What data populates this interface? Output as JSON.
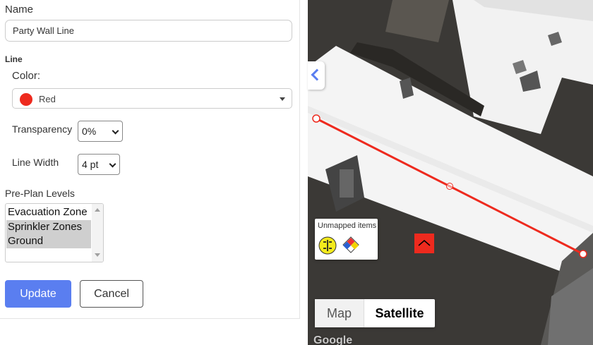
{
  "form": {
    "name_label": "Name",
    "name_value": "Party Wall Line",
    "line_section": "Line",
    "color_label": "Color:",
    "color_value": "Red",
    "color_hex": "#ee2a1e",
    "transparency_label": "Transparency",
    "transparency_value": "0%",
    "line_width_label": "Line Width",
    "line_width_value": "4 pt",
    "preplan_label": "Pre-Plan Levels",
    "preplan_options": [
      "Evacuation Zone",
      "Sprinkler Zones",
      "Ground"
    ],
    "preplan_selected": [
      "Sprinkler Zones",
      "Ground"
    ],
    "update_label": "Update",
    "cancel_label": "Cancel"
  },
  "map": {
    "unmapped_title": "Unmapped items",
    "unmapped_icons": [
      "evacuation-symbol-icon",
      "hazmat-diamond-icon"
    ],
    "marker_icon": "roof-marker-icon",
    "map_button": "Map",
    "satellite_button": "Satellite",
    "selected_type": "Satellite",
    "logo": "Google",
    "line_color": "#ee2a1e"
  }
}
